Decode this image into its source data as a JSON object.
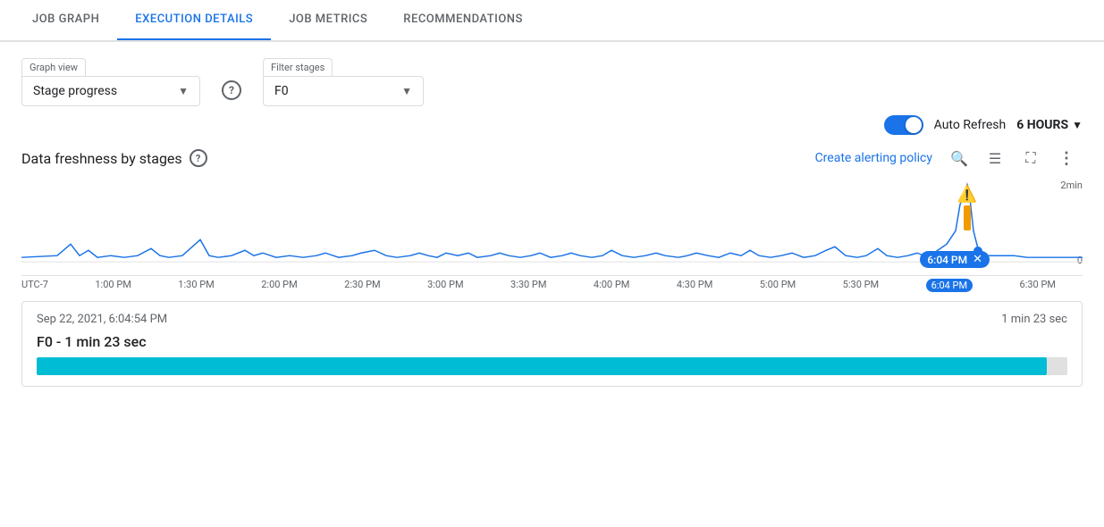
{
  "tabs": [
    {
      "id": "job-graph",
      "label": "JOB GRAPH",
      "active": false
    },
    {
      "id": "execution-details",
      "label": "EXECUTION DETAILS",
      "active": true
    },
    {
      "id": "job-metrics",
      "label": "JOB METRICS",
      "active": false
    },
    {
      "id": "recommendations",
      "label": "RECOMMENDATIONS",
      "active": false
    }
  ],
  "controls": {
    "graph_view": {
      "label": "Graph view",
      "value": "Stage progress",
      "help": "?"
    },
    "filter_stages": {
      "label": "Filter stages",
      "value": "F0"
    }
  },
  "auto_refresh": {
    "label": "Auto Refresh",
    "hours": "6 HOURS",
    "enabled": true
  },
  "chart": {
    "title": "Data freshness by stages",
    "create_policy_label": "Create alerting policy",
    "y_label_top": "2min",
    "y_label_bottom": "0",
    "time_labels": [
      "UTC-7",
      "1:00 PM",
      "1:30 PM",
      "2:00 PM",
      "2:30 PM",
      "3:00 PM",
      "3:30 PM",
      "4:00 PM",
      "4:30 PM",
      "5:00 PM",
      "5:30 PM",
      "6:04 PM",
      "6:30 PM"
    ],
    "selected_time": "6:04 PM",
    "warning": true
  },
  "details": {
    "date": "Sep 22, 2021, 6:04:54 PM",
    "duration": "1 min 23 sec",
    "stage_label": "F0 - 1 min 23 sec",
    "progress_pct": 98
  },
  "icons": {
    "search": "🔍",
    "lines": "≡",
    "fullscreen": "⛶",
    "more": "⋮",
    "chevron_down": "▼",
    "warning": "⚠️",
    "close": "✕",
    "help": "?"
  }
}
